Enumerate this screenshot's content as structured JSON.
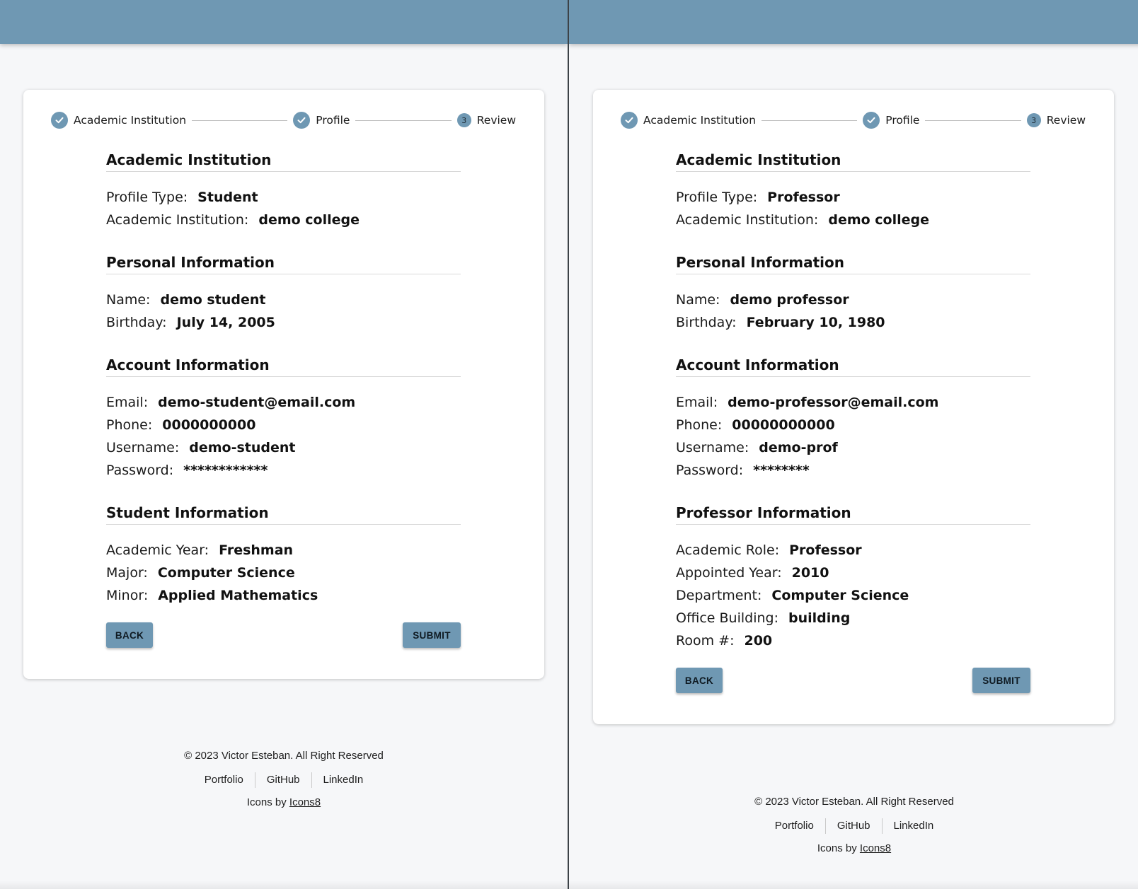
{
  "panels": [
    {
      "steps": [
        "Academic Institution",
        "Profile",
        "Review"
      ],
      "current_step_number": "3",
      "sections": [
        {
          "title": "Academic Institution",
          "rows": [
            {
              "label": "Profile Type:",
              "value": "Student"
            },
            {
              "label": "Academic Institution:",
              "value": "demo college"
            }
          ]
        },
        {
          "title": "Personal Information",
          "rows": [
            {
              "label": "Name:",
              "value": "demo student"
            },
            {
              "label": "Birthday:",
              "value": "July 14, 2005"
            }
          ]
        },
        {
          "title": "Account Information",
          "rows": [
            {
              "label": "Email:",
              "value": "demo-student@email.com"
            },
            {
              "label": "Phone:",
              "value": "0000000000"
            },
            {
              "label": "Username:",
              "value": "demo-student"
            },
            {
              "label": "Password:",
              "value": "************"
            }
          ]
        },
        {
          "title": "Student Information",
          "rows": [
            {
              "label": "Academic Year:",
              "value": "Freshman"
            },
            {
              "label": "Major:",
              "value": "Computer Science"
            },
            {
              "label": "Minor:",
              "value": "Applied Mathematics"
            }
          ]
        }
      ],
      "buttons": {
        "back": "BACK",
        "submit": "SUBMIT"
      },
      "footer": {
        "copyright": "© 2023 Victor Esteban. All Right Reserved",
        "links": [
          "Portfolio",
          "GitHub",
          "LinkedIn"
        ],
        "credit_prefix": "Icons by ",
        "credit_link": "Icons8"
      }
    },
    {
      "steps": [
        "Academic Institution",
        "Profile",
        "Review"
      ],
      "current_step_number": "3",
      "sections": [
        {
          "title": "Academic Institution",
          "rows": [
            {
              "label": "Profile Type:",
              "value": "Professor"
            },
            {
              "label": "Academic Institution:",
              "value": "demo college"
            }
          ]
        },
        {
          "title": "Personal Information",
          "rows": [
            {
              "label": "Name:",
              "value": "demo professor"
            },
            {
              "label": "Birthday:",
              "value": "February 10, 1980"
            }
          ]
        },
        {
          "title": "Account Information",
          "rows": [
            {
              "label": "Email:",
              "value": "demo-professor@email.com"
            },
            {
              "label": "Phone:",
              "value": "00000000000"
            },
            {
              "label": "Username:",
              "value": "demo-prof"
            },
            {
              "label": "Password:",
              "value": "********"
            }
          ]
        },
        {
          "title": "Professor Information",
          "rows": [
            {
              "label": "Academic Role:",
              "value": "Professor"
            },
            {
              "label": "Appointed Year:",
              "value": "2010"
            },
            {
              "label": "Department:",
              "value": "Computer Science"
            },
            {
              "label": "Office Building:",
              "value": "building"
            },
            {
              "label": "Room #:",
              "value": "200"
            }
          ]
        }
      ],
      "buttons": {
        "back": "BACK",
        "submit": "SUBMIT"
      },
      "footer": {
        "copyright": "© 2023 Victor Esteban. All Right Reserved",
        "links": [
          "Portfolio",
          "GitHub",
          "LinkedIn"
        ],
        "credit_prefix": "Icons by ",
        "credit_link": "Icons8"
      }
    }
  ],
  "colors": {
    "accent": "#6f98b3",
    "background": "#f6f7f9",
    "card": "#ffffff"
  },
  "icons": {
    "completed_step": "check-icon"
  }
}
